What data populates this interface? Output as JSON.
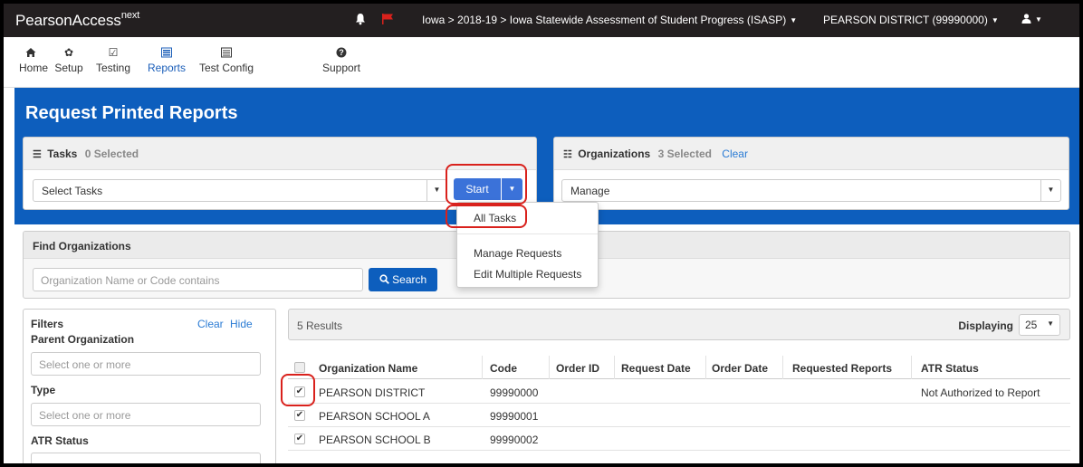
{
  "header": {
    "brand": "PearsonAccess",
    "brand_sup": "next",
    "breadcrumb": "Iowa > 2018-19 > Iowa Statewide Assessment of Student Progress (ISASP)",
    "organization": "PEARSON DISTRICT (99990000)"
  },
  "nav": {
    "items": [
      {
        "label": "Home",
        "icon": "home-icon"
      },
      {
        "label": "Setup",
        "icon": "gear-icon"
      },
      {
        "label": "Testing",
        "icon": "checkbox-icon"
      },
      {
        "label": "Reports",
        "icon": "report-icon"
      },
      {
        "label": "Test Config",
        "icon": "list-icon"
      },
      {
        "label": "Support",
        "icon": "question-icon"
      }
    ],
    "active": "Reports"
  },
  "page": {
    "title": "Request Printed Reports"
  },
  "tasks": {
    "title": "Tasks",
    "selected": "0 Selected",
    "select_placeholder": "Select Tasks",
    "start_label": "Start"
  },
  "organizations": {
    "title": "Organizations",
    "selected": "3 Selected",
    "clear": "Clear",
    "select_value": "Manage"
  },
  "dropdown": {
    "all_tasks": "All Tasks",
    "items": [
      "Manage Requests",
      "Edit Multiple Requests"
    ]
  },
  "find": {
    "title": "Find Organizations",
    "placeholder": "Organization Name or Code contains",
    "search_label": "Search"
  },
  "filters": {
    "title": "Filters",
    "clear": "Clear",
    "hide": "Hide",
    "parent_org_label": "Parent Organization",
    "parent_org_placeholder": "Select one or more",
    "type_label": "Type",
    "type_placeholder": "Select one or more",
    "atr_label": "ATR Status"
  },
  "results": {
    "count": "5 Results",
    "displaying_label": "Displaying",
    "per_page": "25"
  },
  "table": {
    "columns": [
      "Organization Name",
      "Code",
      "Order ID",
      "Request Date",
      "Order Date",
      "Requested Reports",
      "ATR Status"
    ],
    "rows": [
      {
        "name": "PEARSON DISTRICT",
        "code": "99990000",
        "atr": "Not Authorized to Report",
        "checked": true
      },
      {
        "name": "PEARSON SCHOOL A",
        "code": "99990001",
        "atr": "",
        "checked": true
      },
      {
        "name": "PEARSON SCHOOL B",
        "code": "99990002",
        "atr": "",
        "checked": true
      }
    ]
  },
  "colors": {
    "brand_blue": "#0d5ebd",
    "topbar": "#231f20",
    "button_blue": "#3b72d9",
    "highlight_red": "#d9211c",
    "flag_red": "#d9211c"
  }
}
